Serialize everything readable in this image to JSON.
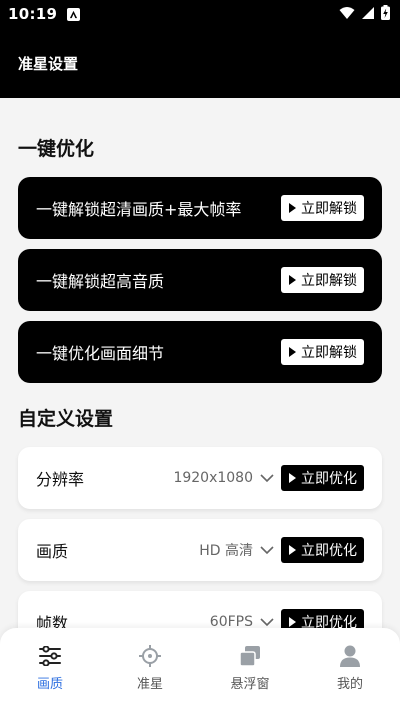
{
  "status": {
    "time": "10:19"
  },
  "appbar": {
    "title": "准星设置"
  },
  "sections": {
    "quick": {
      "title": "一键优化"
    },
    "custom": {
      "title": "自定义设置"
    }
  },
  "quick_items": [
    {
      "label": "一键解锁超清画质+最大帧率",
      "button": "立即解锁"
    },
    {
      "label": "一键解锁超高音质",
      "button": "立即解锁"
    },
    {
      "label": "一键优化画面细节",
      "button": "立即解锁"
    }
  ],
  "custom_items": [
    {
      "label": "分辨率",
      "value": "1920x1080",
      "button": "立即优化"
    },
    {
      "label": "画质",
      "value": "HD 高清",
      "button": "立即优化"
    },
    {
      "label": "帧数",
      "value": "60FPS",
      "button": "立即优化"
    }
  ],
  "nav": [
    {
      "label": "画质",
      "icon": "sliders-icon",
      "active": true
    },
    {
      "label": "准星",
      "icon": "crosshair-icon",
      "active": false
    },
    {
      "label": "悬浮窗",
      "icon": "floating-window-icon",
      "active": false
    },
    {
      "label": "我的",
      "icon": "person-icon",
      "active": false
    }
  ],
  "colors": {
    "accent": "#2e6fe0",
    "dark": "#000000",
    "inactive_icon": "#9aa0a6"
  }
}
